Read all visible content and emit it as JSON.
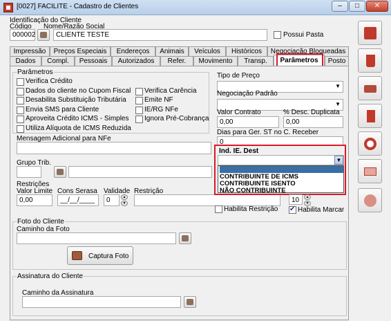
{
  "window": {
    "title": "[0027] FACILITE - Cadastro de Clientes",
    "minimize": "–",
    "maximize": "□",
    "close": "✕"
  },
  "header": {
    "section_label": "Identificação do Cliente",
    "codigo_label": "Código",
    "nome_label": "Nome/Razão Social",
    "codigo_value": "000002",
    "nome_value": "CLIENTE TESTE",
    "possui_pasta_label": "Possui Pasta"
  },
  "tabs": {
    "row1": [
      "Impressão",
      "Preços Especiais",
      "Endereços",
      "Animais",
      "Veículos",
      "Históricos",
      "Negociação Bloqueadas"
    ],
    "row2": [
      "Dados",
      "Compl.",
      "Pessoais",
      "Autorizados",
      "Refer.",
      "Movimento",
      "Transp.",
      "Parâmetros",
      "Posto"
    ]
  },
  "parametros": {
    "group_label": "Parâmetros",
    "checkboxes_left": [
      {
        "label": "Verifica Crédito",
        "checked": false
      },
      {
        "label": "Dados do cliente no Cupom Fiscal",
        "checked": false
      },
      {
        "label": "Desabilita Substituição Tributária",
        "checked": false
      },
      {
        "label": "Envia SMS para Cliente",
        "checked": false
      },
      {
        "label": "Aproveita Crédito ICMS - Simples",
        "checked": false
      },
      {
        "label": "Utiliza Alíquota de ICMS Reduzida",
        "checked": false
      }
    ],
    "checkboxes_right": [
      {
        "label": "Verifica Carência",
        "checked": false
      },
      {
        "label": "Emite NF",
        "checked": false
      },
      {
        "label": "IE/RG NFe",
        "checked": false
      },
      {
        "label": "Ignora Pré-Cobrança",
        "checked": false
      }
    ],
    "mensagem_label": "Mensagem Adicional para NFe",
    "grupo_trib_label": "Grupo Trib.",
    "tipo_preco_label": "Tipo de Preço",
    "negociacao_padrao_label": "Negociação Padrão",
    "valor_contrato_label": "Valor Contrato",
    "valor_contrato_value": "0,00",
    "desc_duplicata_label": "% Desc. Duplicata",
    "desc_duplicata_value": "0,00",
    "dias_st_label": "Dias para Ger. ST no C. Receber",
    "dias_st_value": "0",
    "ind_ie_label": "Ind. IE. Dest",
    "ind_ie_options": [
      "",
      "CONTRIBUINTE DE ICMS",
      "CONTRIBUINTE ISENTO",
      "NÃO CONTRIBUINTE"
    ],
    "ind_ie_selected": "",
    "restricoes_label": "Restrições",
    "valor_limite_label": "Valor Limite",
    "valor_limite_value": "0,00",
    "cons_serasa_label": "Cons Serasa",
    "cons_serasa_value": "__/__/____",
    "validade_label": "Validade",
    "validade_value": "0",
    "restricao_label": "Restrição",
    "habilita_restricao_label": "Habilita Restrição",
    "habilita_restricao_checked": false,
    "right_spin_value": "10",
    "habilita_marcar_label": "Habilita Marcar",
    "habilita_marcar_checked": true
  },
  "foto": {
    "group_label": "Foto do Cliente",
    "caminho_label": "Caminho da Foto",
    "captura_label": "Captura Foto"
  },
  "assinatura": {
    "group_label": "Assinatura do Cliente",
    "caminho_label": "Caminho da Assinatura"
  },
  "toolbar": [
    "save-icon",
    "delete-icon",
    "print-icon",
    "exit-icon",
    "help-icon",
    "id-card-icon",
    "settings-icon"
  ],
  "colors": {
    "highlight": "#d9192a",
    "dropdown_selected": "#3a6ea5"
  }
}
